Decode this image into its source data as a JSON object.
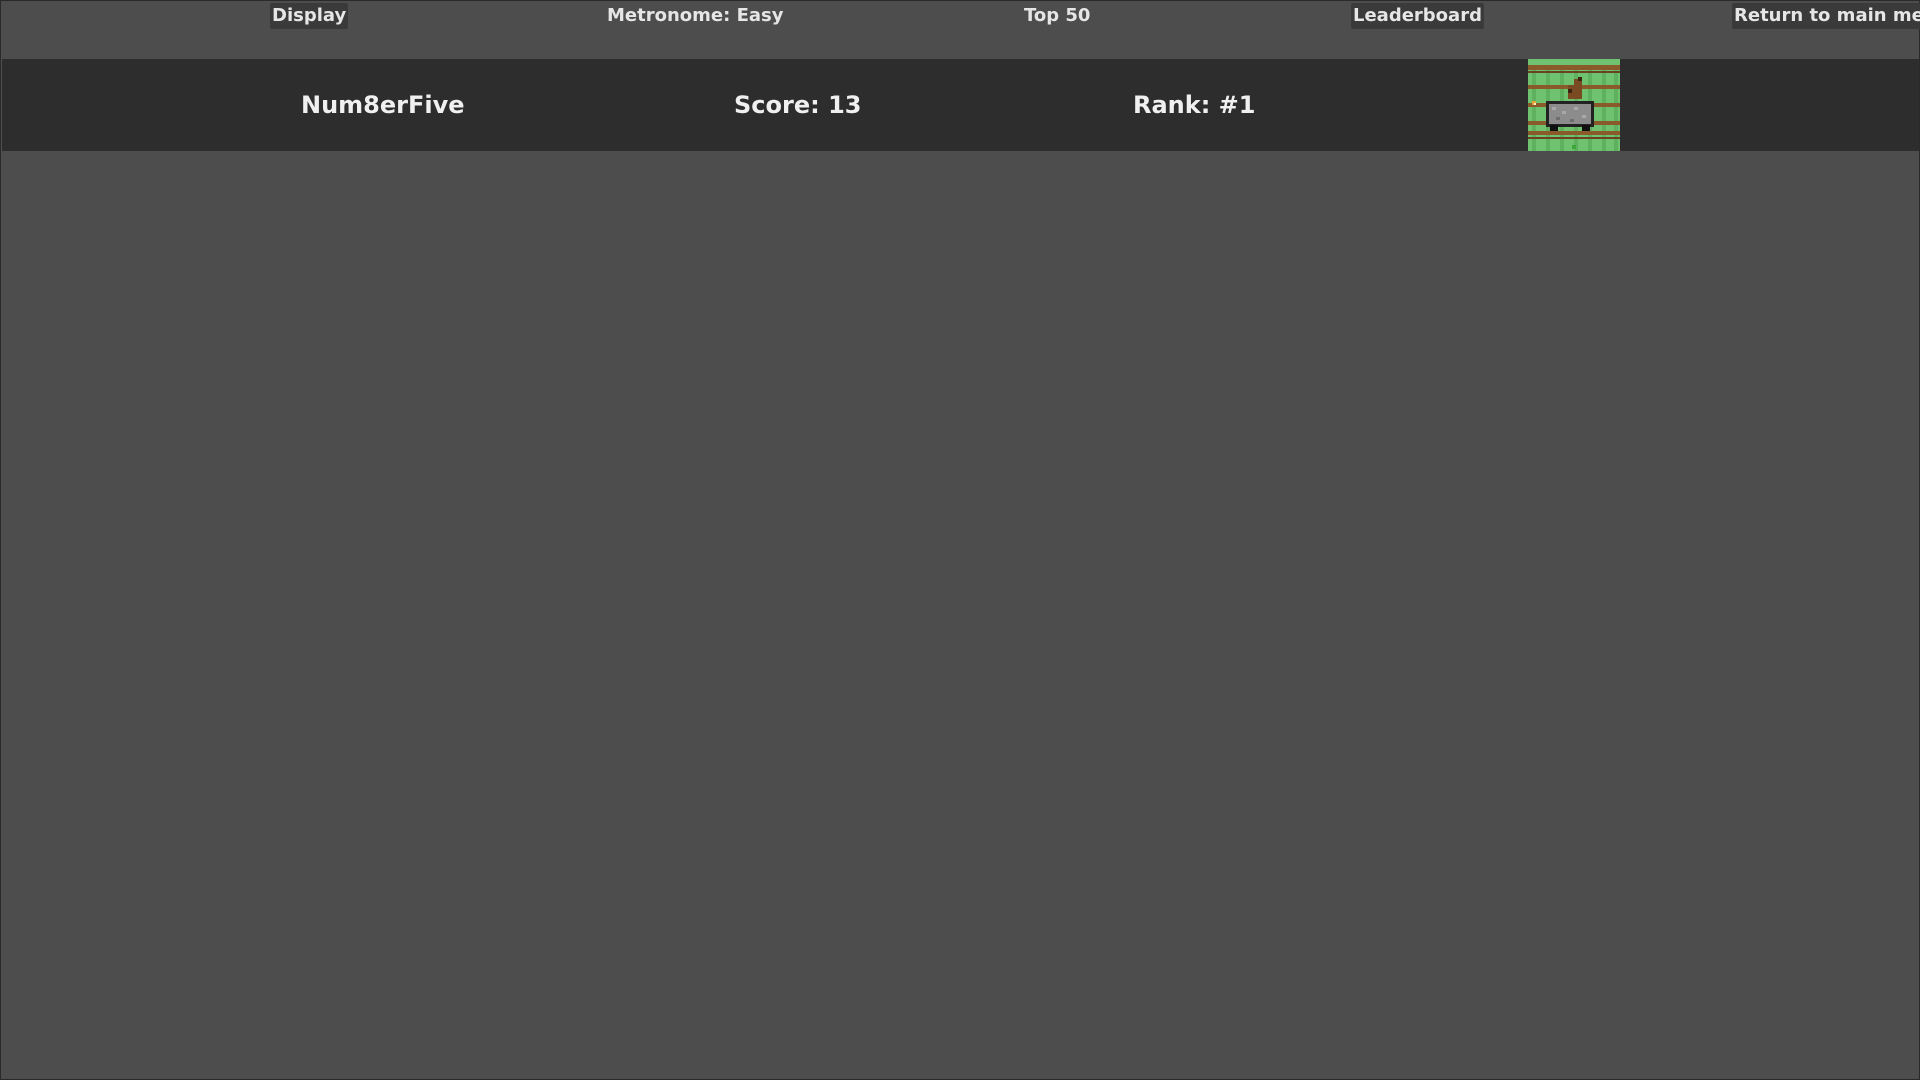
{
  "topbar": {
    "display_label": "Display",
    "mode_label": "Metronome: Easy",
    "scope_label": "Top 50",
    "leaderboard_label": "Leaderboard",
    "return_label": "Return to main menu"
  },
  "leaderboard": {
    "entries": [
      {
        "name": "Num8erFive",
        "score_text": "Score: 13",
        "rank_text": "Rank: #1",
        "avatar_icon": "horse-in-minecart-icon"
      }
    ]
  },
  "colors": {
    "background": "#4d4d4d",
    "row_background": "#2d2d2d",
    "button_background": "#3a3a3a",
    "grass_green": "#6fc26f",
    "rail_brown": "#8b5a2b"
  }
}
